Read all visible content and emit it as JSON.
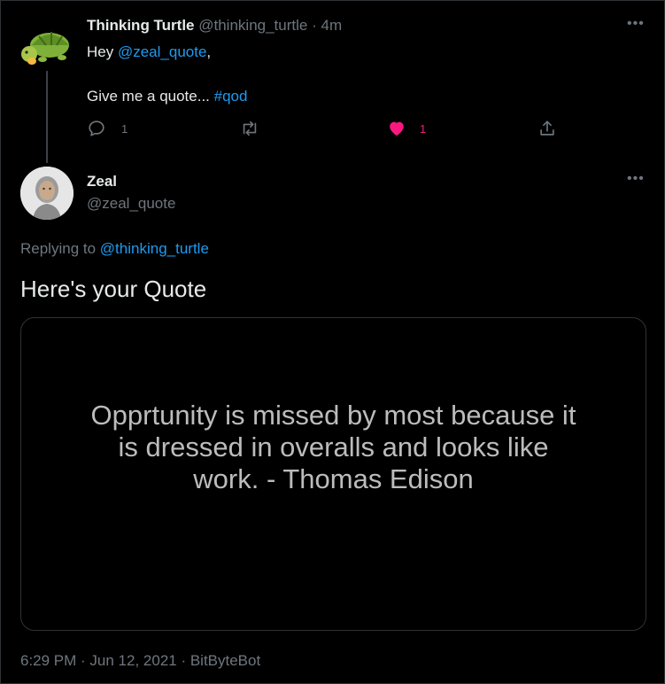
{
  "tweet": {
    "name": "Thinking Turtle",
    "handle": "@thinking_turtle",
    "separator": "·",
    "time_ago": "4m",
    "body_hey": "Hey",
    "mention": "@zeal_quote",
    "comma": ",",
    "body_line2": "Give me a quote...",
    "hashtag": "#qod",
    "reply_count": "1",
    "like_count": "1",
    "more_glyph": "•••"
  },
  "reply": {
    "name": "Zeal",
    "handle": "@zeal_quote",
    "replying_prefix": "Replying to",
    "replying_to": "@thinking_turtle",
    "headline": "Here's your Quote",
    "more_glyph": "•••",
    "quote_lines": [
      "Opprtunity is missed by most because it",
      "is dressed in overalls and looks like",
      "work. - Thomas Edison"
    ],
    "footer": "6:29 PM · Jun 12, 2021 · BitByteBot"
  },
  "colors": {
    "background": "#000000",
    "link": "#1d9bf0",
    "like": "#f91880",
    "muted": "#6e767d"
  },
  "icons": [
    "turtle-avatar",
    "zeal-avatar",
    "reply-icon",
    "retweet-icon",
    "heart-icon",
    "share-icon",
    "more-icon"
  ]
}
